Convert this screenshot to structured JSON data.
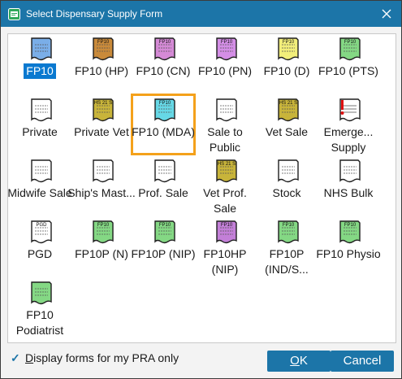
{
  "window": {
    "title": "Select Dispensary Supply Form"
  },
  "tiles": [
    {
      "label": "FP10",
      "code": "",
      "color": "#7aaee8",
      "icon": "blue-form-icon"
    },
    {
      "label": "FP10 (HP)",
      "code": "FP10",
      "color": "#c98a3a",
      "icon": "hp-form-icon"
    },
    {
      "label": "FP10 (CN)",
      "code": "FP10",
      "color": "#d58ad6",
      "icon": "cn-form-icon"
    },
    {
      "label": "FP10 (PN)",
      "code": "FP10",
      "color": "#d48ee6",
      "icon": "pn-form-icon"
    },
    {
      "label": "FP10 (D)",
      "code": "FP10",
      "color": "#f2ee7a",
      "icon": "dental-form-icon"
    },
    {
      "label": "FP10 (PTS)",
      "code": "FP10",
      "color": "#84d884",
      "icon": "pts-form-icon"
    },
    {
      "label": "Private",
      "code": "",
      "color": "#ffffff",
      "icon": "private-form-icon"
    },
    {
      "label": "Private Vet",
      "code": "HS 21 S",
      "color": "#c8b43a",
      "icon": "private-vet-form-icon"
    },
    {
      "label": "FP10 (MDA)",
      "code": "FP10",
      "color": "#66d8e6",
      "icon": "mda-form-icon"
    },
    {
      "label": "Sale to Public",
      "code": "",
      "color": "#ffffff",
      "icon": "sale-form-icon"
    },
    {
      "label": "Vet Sale",
      "code": "HS 21 S",
      "color": "#c8b43a",
      "icon": "vet-sale-form-icon"
    },
    {
      "label": "Emerge... Supply",
      "code": "",
      "color": "#ffffff",
      "icon": "emergency-form-icon"
    },
    {
      "label": "Midwife Sale",
      "code": "",
      "color": "#ffffff",
      "icon": "midwife-form-icon"
    },
    {
      "label": "Ship's Mast...",
      "code": "",
      "color": "#ffffff",
      "icon": "ships-master-form-icon"
    },
    {
      "label": "Prof. Sale",
      "code": "",
      "color": "#ffffff",
      "icon": "prof-sale-form-icon"
    },
    {
      "label": "Vet Prof. Sale",
      "code": "HS 21 S",
      "color": "#c8b43a",
      "icon": "vet-prof-form-icon"
    },
    {
      "label": "Stock",
      "code": "",
      "color": "#ffffff",
      "icon": "stock-form-icon"
    },
    {
      "label": "NHS Bulk",
      "code": "",
      "color": "#ffffff",
      "icon": "nhs-bulk-form-icon"
    },
    {
      "label": "PGD",
      "code": "PGD",
      "color": "#ffffff",
      "icon": "pgd-form-icon"
    },
    {
      "label": "FP10P (N)",
      "code": "FP10",
      "color": "#84d884",
      "icon": "fp10p-n-form-icon"
    },
    {
      "label": "FP10P (NIP)",
      "code": "FP10",
      "color": "#84d884",
      "icon": "fp10p-nip-form-icon"
    },
    {
      "label": "FP10HP (NIP)",
      "code": "FP10",
      "color": "#c37fd8",
      "icon": "fp10hp-nip-form-icon"
    },
    {
      "label": "FP10P (IND/S...",
      "code": "FP10",
      "color": "#84d884",
      "icon": "fp10p-ind-form-icon"
    },
    {
      "label": "FP10 Physio",
      "code": "FP10",
      "color": "#84d884",
      "icon": "physio-form-icon"
    },
    {
      "label": "FP10 Podiatrist",
      "code": "",
      "color": "#84d884",
      "icon": "podiatrist-form-icon"
    }
  ],
  "footer": {
    "check_prefix": "D",
    "check_rest": "isplay forms for my PRA only",
    "checked": true,
    "ok_u": "O",
    "ok_rest": "K",
    "cancel": "Cancel"
  }
}
